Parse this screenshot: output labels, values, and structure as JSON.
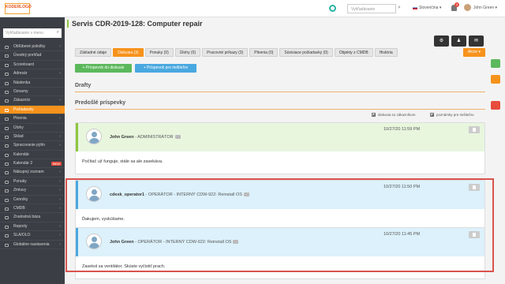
{
  "colors": {
    "accent": "#f7921c",
    "sidebar": "#3b3f45",
    "green": "#5cb85c",
    "blue": "#4aa8e0",
    "highlight": "#d9534f"
  },
  "topbar": {
    "logo": "KODERLOGO",
    "search_placeholder": "Vyhľadávanie",
    "language": "Slovenčina",
    "notifications": "4",
    "user": "John Green"
  },
  "sidebar": {
    "search_placeholder": "Vyhľadávanie v menu",
    "items": [
      {
        "label": "Obľúbené položky",
        "arrow": "›"
      },
      {
        "label": "Úvodný prehľad"
      },
      {
        "label": "Scoreboard"
      },
      {
        "label": "Adresár",
        "arrow": "›"
      },
      {
        "label": "Nástenka"
      },
      {
        "label": "Oznamy"
      },
      {
        "label": "Zákazníci",
        "arrow": "›"
      },
      {
        "label": "Požiadavky",
        "arrow": "›"
      },
      {
        "label": "Plnenia",
        "arrow": "›"
      },
      {
        "label": "Úlohy"
      },
      {
        "label": "Sklad",
        "arrow": "›"
      },
      {
        "label": "Spracovanie pýtín",
        "arrow": "›"
      },
      {
        "label": "Kalendár"
      },
      {
        "label": "Kalendár 2",
        "badge": "NEW"
      },
      {
        "label": "Nákupný zoznam",
        "arrow": "›"
      },
      {
        "label": "Ponuky",
        "arrow": "›"
      },
      {
        "label": "Zmluvy",
        "arrow": "›"
      },
      {
        "label": "Cenníky",
        "arrow": "›"
      },
      {
        "label": "CMDB",
        "arrow": "›"
      },
      {
        "label": "Znalostná báza"
      },
      {
        "label": "Reporty",
        "arrow": "›"
      },
      {
        "label": "SLA/OLO",
        "arrow": "›"
      },
      {
        "label": "Globálne nastavenia",
        "arrow": "›"
      }
    ]
  },
  "page": {
    "title": "Servis CDR-2019-128: Computer repair",
    "actions_label": "Akcie ▾",
    "header_icons": [
      "gear-icon",
      "user-icon",
      "mail-icon"
    ]
  },
  "tabs": [
    {
      "label": "Základné údaje"
    },
    {
      "label": "Diskusia (3)",
      "active": true
    },
    {
      "label": "Ponuky (0)"
    },
    {
      "label": "Úlohy (0)"
    },
    {
      "label": "Pracovné príkazy (3)"
    },
    {
      "label": "Plnenia (0)"
    },
    {
      "label": "Súvisiace požiadavky (0)"
    },
    {
      "label": "Objekty z CMDB"
    },
    {
      "label": "História"
    }
  ],
  "buttons": {
    "add_discussion": "+ Príspevok do diskusie",
    "add_managers": "+ Príspevok pre riešiteľov"
  },
  "sections": {
    "drafts": "Drafty",
    "previous": "Predošlé príspevky"
  },
  "filters": {
    "customer": "diskusia so zákazníkom",
    "internal": "poznámky pre riešiteľov"
  },
  "posts": [
    {
      "author": "John Green",
      "role": " - ADMINISTRÁTOR",
      "date": "10/27/20 11:59 PM",
      "text": "Počítač už funguje, stále sa ale zasekáva."
    },
    {
      "author": "cdesk_operator1",
      "role": " - OPERÁTOR - INTERNÝ CDW-922: Reinstall OS",
      "date": "10/27/20 11:50 PM",
      "text": "Ďakujem, vyskúšame."
    },
    {
      "author": "John Green",
      "role": " - OPERÁTOR - INTERNÝ CDW-922: Reinstall OS",
      "date": "10/27/20 11:45 PM",
      "text": "Zasekol sa ventilátor. Skúste vyčistiť prach."
    }
  ]
}
